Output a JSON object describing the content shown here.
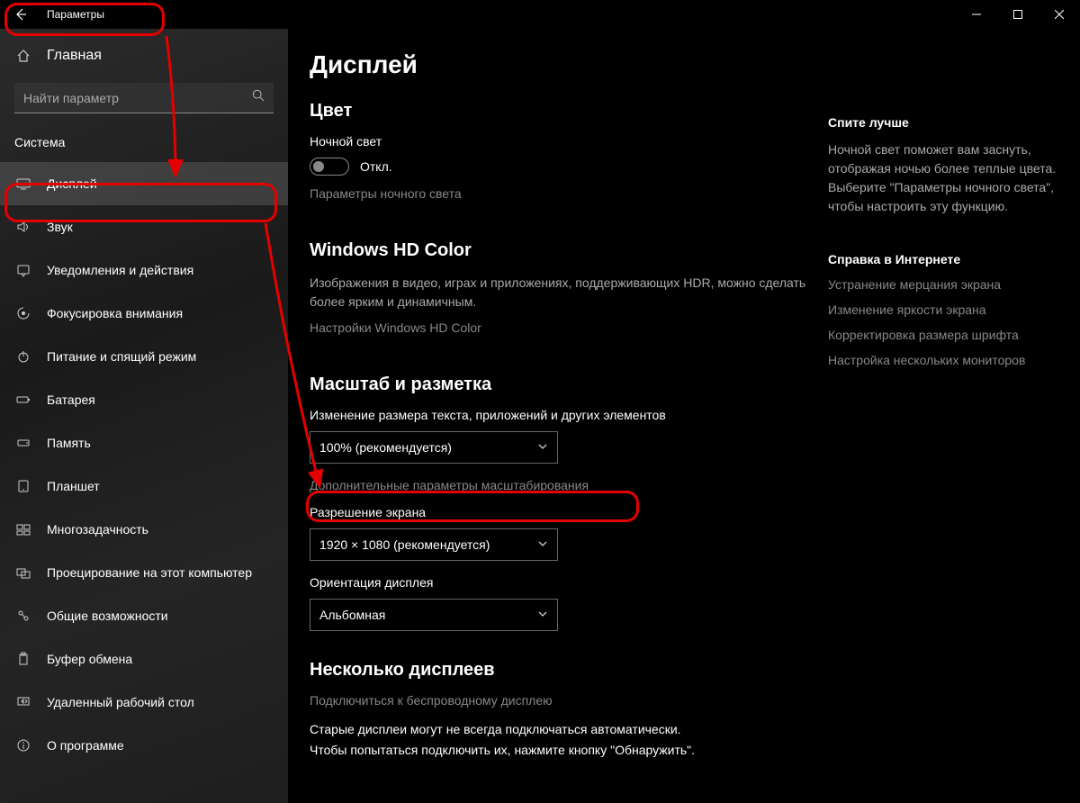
{
  "window": {
    "title": "Параметры"
  },
  "sidebar": {
    "home": "Главная",
    "search_placeholder": "Найти параметр",
    "section": "Система",
    "items": [
      {
        "icon": "display",
        "label": "Дисплей",
        "active": true
      },
      {
        "icon": "sound",
        "label": "Звук"
      },
      {
        "icon": "notify",
        "label": "Уведомления и действия"
      },
      {
        "icon": "focus",
        "label": "Фокусировка внимания"
      },
      {
        "icon": "power",
        "label": "Питание и спящий режим"
      },
      {
        "icon": "battery",
        "label": "Батарея"
      },
      {
        "icon": "storage",
        "label": "Память"
      },
      {
        "icon": "tablet",
        "label": "Планшет"
      },
      {
        "icon": "multitask",
        "label": "Многозадачность"
      },
      {
        "icon": "project",
        "label": "Проецирование на этот компьютер"
      },
      {
        "icon": "shared",
        "label": "Общие возможности"
      },
      {
        "icon": "clipboard",
        "label": "Буфер обмена"
      },
      {
        "icon": "rdp",
        "label": "Удаленный рабочий стол"
      },
      {
        "icon": "about",
        "label": "О программе"
      }
    ]
  },
  "main": {
    "title": "Дисплей",
    "color": {
      "heading": "Цвет",
      "night_label": "Ночной свет",
      "toggle_state": "Откл.",
      "night_link": "Параметры ночного света"
    },
    "hdcolor": {
      "heading": "Windows HD Color",
      "desc": "Изображения в видео, играх и приложениях, поддерживающих HDR, можно сделать более ярким и динамичным.",
      "link": "Настройки Windows HD Color"
    },
    "scale": {
      "heading": "Масштаб и разметка",
      "size_label": "Изменение размера текста, приложений и других элементов",
      "size_value": "100% (рекомендуется)",
      "adv_link": "Дополнительные параметры масштабирования",
      "res_label": "Разрешение экрана",
      "res_value": "1920 × 1080 (рекомендуется)",
      "orient_label": "Ориентация дисплея",
      "orient_value": "Альбомная"
    },
    "multi": {
      "heading": "Несколько дисплеев",
      "connect_link": "Подключиться к беспроводному дисплею",
      "old_text1": "Старые дисплеи могут не всегда подключаться автоматически.",
      "old_text2": "Чтобы попытаться подключить их, нажмите кнопку \"Обнаружить\"."
    }
  },
  "right": {
    "sleep_heading": "Спите лучше",
    "sleep_text": "Ночной свет поможет вам заснуть, отображая ночью более теплые цвета. Выберите \"Параметры ночного света\", чтобы настроить эту функцию.",
    "help_heading": "Справка в Интернете",
    "links": [
      "Устранение мерцания экрана",
      "Изменение яркости экрана",
      "Корректировка размера шрифта",
      "Настройка нескольких мониторов"
    ]
  }
}
